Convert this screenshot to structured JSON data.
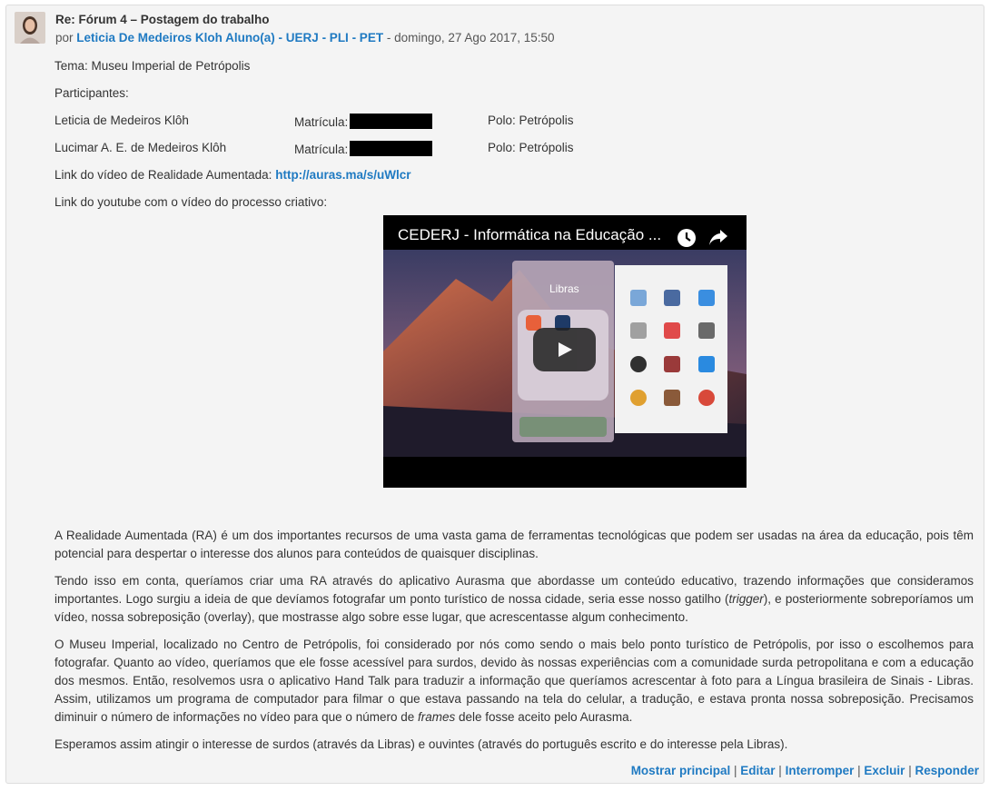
{
  "post": {
    "subject": "Re: Fórum 4 – Postagem do trabalho",
    "by_prefix": "por",
    "author": "Leticia De Medeiros Kloh Aluno(a) - UERJ - PLI - PET",
    "date": "- domingo, 27 Ago 2017, 15:50"
  },
  "content": {
    "tema": "Tema: Museu Imperial de Petrópolis",
    "participantes": "Participantes:",
    "rows": [
      {
        "name": "Leticia de Medeiros Klôh",
        "mat": "Matrícula:",
        "polo": "Polo: Petrópolis"
      },
      {
        "name": "Lucimar A. E. de Medeiros Klôh",
        "mat": "Matrícula:",
        "polo": "Polo: Petrópolis"
      }
    ],
    "ra_link_label": "Link do vídeo de Realidade Aumentada:",
    "ra_link": "http://auras.ma/s/uWlcr",
    "youtube_label": "Link do youtube com o vídeo do processo criativo:",
    "video_title": "CEDERJ - Informática na Educação ...",
    "video_overlay_label": "Libras",
    "p1": "A Realidade Aumentada (RA) é um dos importantes recursos de uma vasta gama de ferramentas tecnológicas que podem ser usadas na área da educação, pois têm potencial para despertar o interesse dos alunos para conteúdos de quaisquer disciplinas.",
    "p2_a": "Tendo isso em conta, queríamos criar uma RA através do aplicativo Aurasma que abordasse um conteúdo educativo, trazendo informações que consideramos importantes. Logo surgiu a ideia de que devíamos fotografar um ponto turístico de nossa cidade, seria esse nosso gatilho (",
    "p2_em": "trigger",
    "p2_b": "), e posteriormente sobreporíamos um vídeo, nossa sobreposição (overlay), que mostrasse algo sobre esse lugar, que acrescentasse algum conhecimento.",
    "p3_a": "O Museu Imperial, localizado no Centro de Petrópolis, foi considerado por nós como sendo o mais belo ponto turístico de Petrópolis, por isso o escolhemos para fotografar.  Quanto ao vídeo, queríamos que ele fosse acessível para surdos, devido às nossas experiências com a comunidade surda petropolitana e com a educação dos mesmos. Então, resolvemos usra o aplicativo Hand Talk para traduzir a informação que queríamos acrescentar à foto para a Língua brasileira de Sinais - Libras. Assim, utilizamos um programa de computador para filmar o que estava passando na tela do celular, a tradução, e estava pronta nossa sobreposição. Precisamos diminuir o número de informações no vídeo para que o número de ",
    "p3_em": "frames",
    "p3_b": " dele fosse aceito pelo Aurasma.",
    "p4": "Esperamos assim atingir o interesse de surdos (através da Libras) e ouvintes (através do português escrito e do interesse pela Libras)."
  },
  "actions": {
    "show_parent": "Mostrar principal",
    "edit": "Editar",
    "split": "Interromper",
    "delete": "Excluir",
    "reply": "Responder",
    "sep": "|"
  },
  "colors": {
    "link": "#1f7ac2",
    "panel_bg": "#f4f4f4",
    "border": "#dddddd"
  }
}
